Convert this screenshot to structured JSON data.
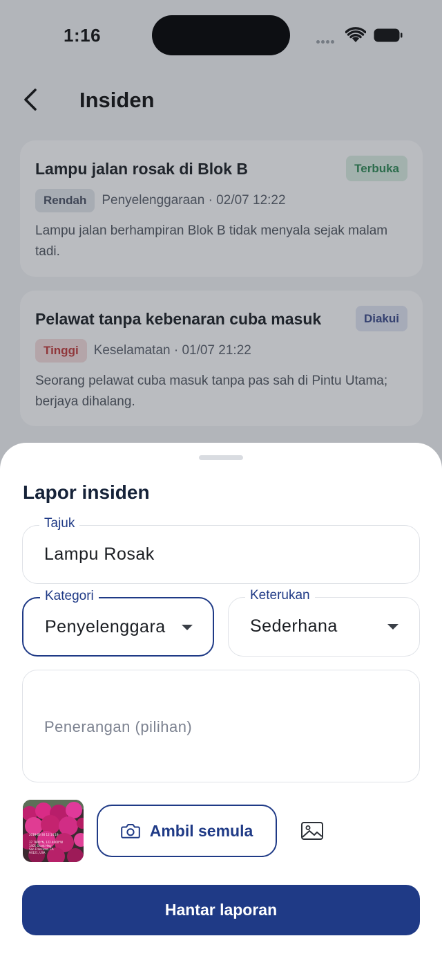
{
  "status_bar": {
    "time": "1:16"
  },
  "header": {
    "title": "Insiden"
  },
  "incidents": [
    {
      "title": "Lampu jalan rosak di Blok B",
      "status": "Terbuka",
      "status_colors": {
        "bg": "#dcefe4",
        "fg": "#2f8a55"
      },
      "severity": "Rendah",
      "severity_colors": {
        "bg": "#e4e7ec",
        "fg": "#4a5264"
      },
      "meta": "Penyelenggaraan · 02/07 12:22",
      "description": "Lampu jalan berhampiran Blok B tidak menyala sejak malam tadi."
    },
    {
      "title": "Pelawat tanpa kebenaran cuba masuk",
      "status": "Diakui",
      "status_colors": {
        "bg": "#e2e6f4",
        "fg": "#3b4a8a"
      },
      "severity": "Tinggi",
      "severity_colors": {
        "bg": "#f6dede",
        "fg": "#c23a3a"
      },
      "meta": "Keselamatan · 01/07 21:22",
      "description": "Seorang pelawat cuba masuk tanpa pas sah di Pintu Utama; berjaya dihalang."
    }
  ],
  "sheet": {
    "title": "Lapor insiden",
    "title_field": {
      "label": "Tajuk",
      "value": "Lampu Rosak"
    },
    "category_field": {
      "label": "Kategori",
      "value": "Penyelenggara"
    },
    "urgency_field": {
      "label": "Keterukan",
      "value": "Sederhana"
    },
    "description_field": {
      "placeholder": "Penerangan (pilihan)"
    },
    "photo": {
      "caption_lines": [
        "2018-03-30 12:14:19",
        "37.7800°N, 122.4000°W",
        "1401 Grant Hwy",
        "San Francisco, CA",
        "94121, USA"
      ]
    },
    "retake_label": "Ambil semula",
    "gallery_icon": "image-icon",
    "submit_label": "Hantar laporan"
  },
  "colors": {
    "primary": "#1f3a86",
    "overlay": "rgba(40,46,58,0.32)"
  }
}
